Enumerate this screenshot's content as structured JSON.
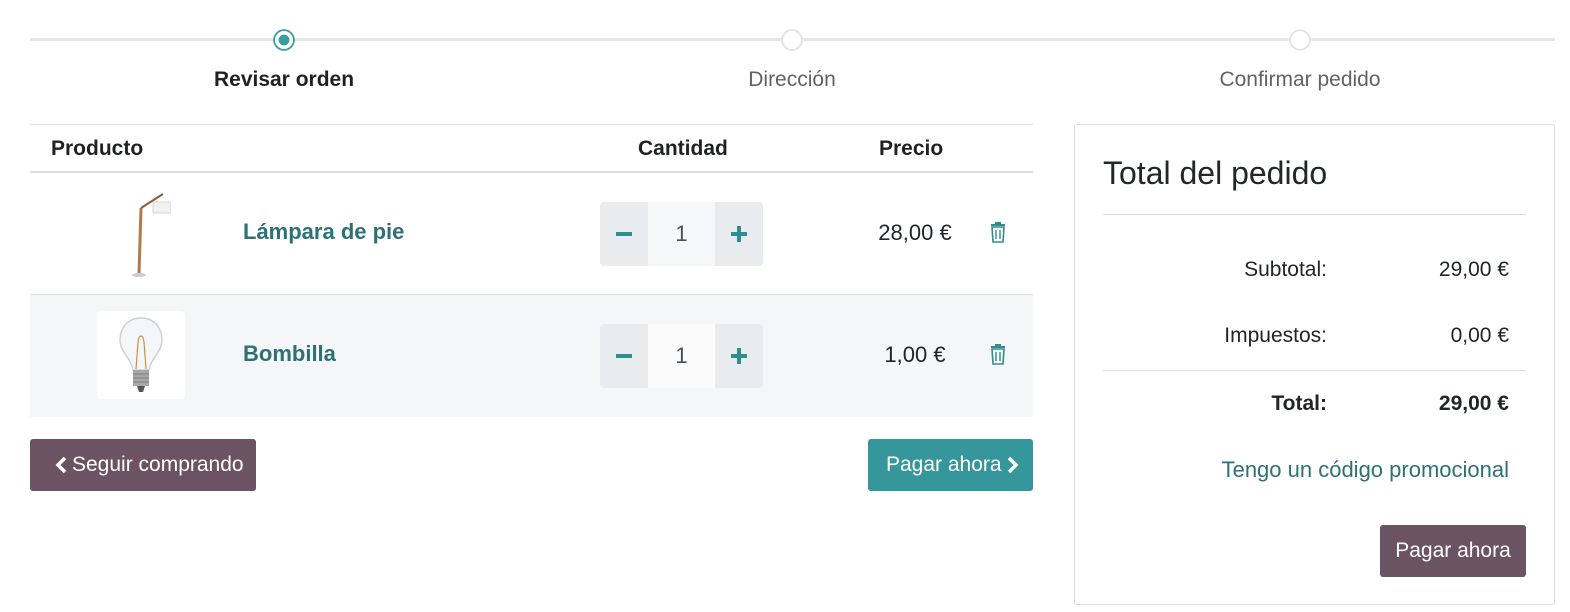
{
  "steps": [
    {
      "label": "Revisar orden",
      "active": true
    },
    {
      "label": "Dirección",
      "active": false
    },
    {
      "label": "Confirmar pedido",
      "active": false
    }
  ],
  "cart": {
    "headers": {
      "product": "Producto",
      "quantity": "Cantidad",
      "price": "Precio"
    },
    "rows": [
      {
        "name": "Lámpara de pie",
        "quantity": "1",
        "price": "28,00 €"
      },
      {
        "name": "Bombilla",
        "quantity": "1",
        "price": "1,00 €"
      }
    ]
  },
  "buttons": {
    "continue_shopping": "Seguir comprando",
    "pay_now": "Pagar ahora"
  },
  "summary": {
    "title": "Total del pedido",
    "subtotal_label": "Subtotal:",
    "subtotal_value": "29,00 €",
    "taxes_label": "Impuestos:",
    "taxes_value": "0,00 €",
    "total_label": "Total:",
    "total_value": "29,00 €",
    "promo_link": "Tengo un código promocional",
    "pay_button": "Pagar ahora"
  },
  "colors": {
    "accent_teal": "#35979b",
    "link_teal": "#2c7176",
    "button_plum": "#6b5363"
  },
  "icons": [
    "minus-icon",
    "plus-icon",
    "trash-icon",
    "chevron-left-icon",
    "chevron-right-icon"
  ]
}
